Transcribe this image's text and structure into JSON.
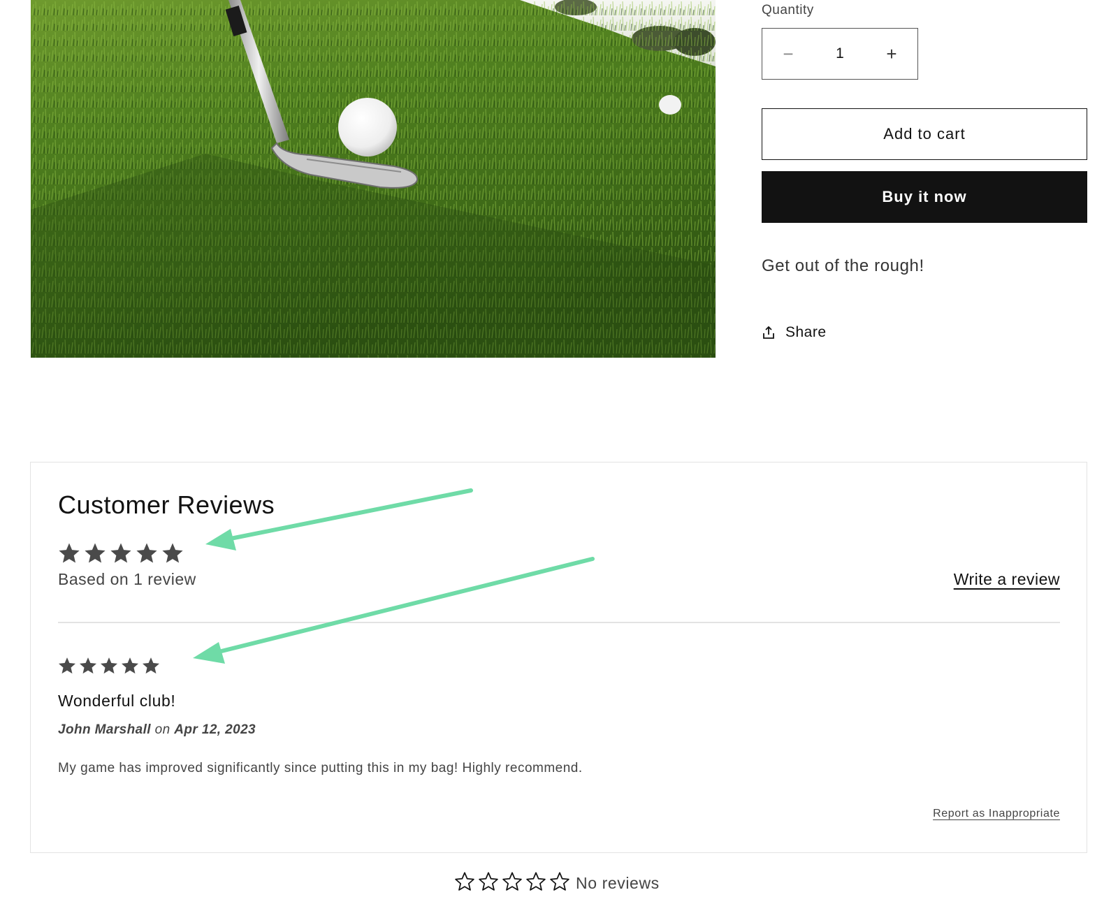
{
  "product": {
    "quantity_label": "Quantity",
    "quantity_value": "1",
    "minus_symbol": "−",
    "plus_symbol": "+",
    "add_to_cart_label": "Add to cart",
    "buy_now_label": "Buy it now",
    "tagline": "Get out of the rough!",
    "share_label": "Share"
  },
  "reviews": {
    "title": "Customer Reviews",
    "average_rating": 5,
    "max_rating": 5,
    "summary_text": "Based on 1 review",
    "write_review_label": "Write a review",
    "items": [
      {
        "rating": 5,
        "title": "Wonderful club!",
        "author": "John Marshall",
        "on_word": "on",
        "date": "Apr 12, 2023",
        "body": "My game has improved significantly since putting this in my bag! Highly recommend.",
        "report_label": "Report as Inappropriate"
      }
    ]
  },
  "badge": {
    "rating": 0,
    "text": "No reviews"
  },
  "colors": {
    "star_filled": "#4a4a4a",
    "star_outline": "#121212",
    "annotation_arrow": "#6fdba7",
    "button_dark": "#121212"
  },
  "icons": {
    "share": "share-icon",
    "minus": "minus-icon",
    "plus": "plus-icon",
    "star": "star-icon"
  }
}
